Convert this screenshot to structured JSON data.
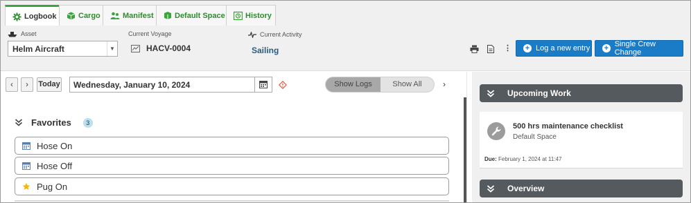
{
  "tabs": [
    {
      "label": "Logbook",
      "icon": "logbook-gear-icon",
      "active": true
    },
    {
      "label": "Cargo",
      "icon": "cargo-icon",
      "active": false
    },
    {
      "label": "Manifest",
      "icon": "manifest-people-icon",
      "active": false
    },
    {
      "label": "Default Space",
      "icon": "default-space-icon",
      "active": false
    },
    {
      "label": "History",
      "icon": "history-icon",
      "active": false
    }
  ],
  "header": {
    "asset_label": "Asset",
    "asset_value": "Helm Aircraft",
    "voyage_label": "Current Voyage",
    "voyage_value": "HACV-0004",
    "activity_label": "Current Activity",
    "activity_value": "Sailing",
    "log_button": "Log a new entry",
    "crew_button": "Single Crew Change",
    "more_icon": "⋮"
  },
  "datebar": {
    "prev": "‹",
    "next_small": "›",
    "today": "Today",
    "date_value": "Wednesday, January 10, 2024",
    "show_logs": "Show Logs",
    "show_all": "Show All",
    "forward": "›"
  },
  "favorites": {
    "title": "Favorites",
    "count": "3",
    "items": [
      {
        "label": "Hose On",
        "icon": "calendar-icon"
      },
      {
        "label": "Hose Off",
        "icon": "calendar-icon"
      },
      {
        "label": "Pug On",
        "icon": "star-icon"
      }
    ]
  },
  "upcoming": {
    "title": "Upcoming Work",
    "work_title": "500 hrs maintenance checklist",
    "work_space": "Default Space",
    "due_label": "Due:",
    "due_value": "February 1, 2024 at 11:47"
  },
  "overview": {
    "title": "Overview"
  },
  "colors": {
    "accent_green": "#3aa53a",
    "primary_blue": "#1a7bc7",
    "section_header": "#555a5e",
    "activity_text": "#2c5d7d"
  }
}
